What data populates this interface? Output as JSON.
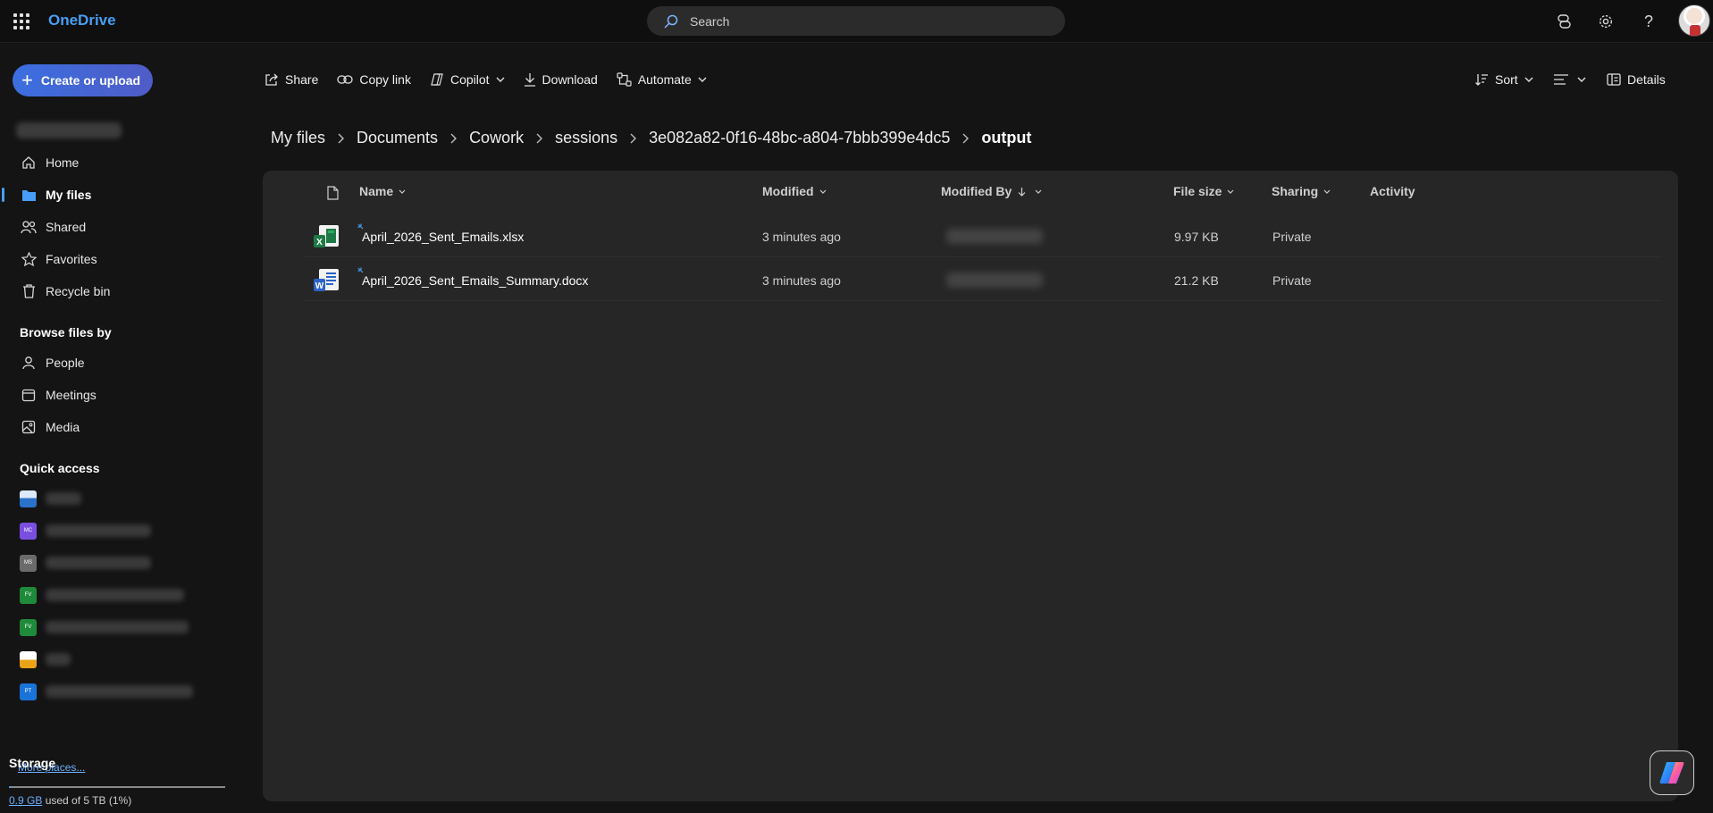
{
  "app": {
    "name": "OneDrive"
  },
  "search": {
    "placeholder": "Search"
  },
  "sidebar": {
    "create_label": "Create or upload",
    "nav": [
      {
        "label": "Home",
        "icon": "home-icon"
      },
      {
        "label": "My files",
        "icon": "folder-icon",
        "active": true
      },
      {
        "label": "Shared",
        "icon": "people-icon"
      },
      {
        "label": "Favorites",
        "icon": "star-icon"
      },
      {
        "label": "Recycle bin",
        "icon": "trash-icon"
      }
    ],
    "browse_heading": "Browse files by",
    "browse": [
      {
        "label": "People",
        "icon": "person-icon"
      },
      {
        "label": "Meetings",
        "icon": "calendar-icon"
      },
      {
        "label": "Media",
        "icon": "image-icon"
      }
    ],
    "quick_access_heading": "Quick access",
    "quick_access": [
      {
        "badge": "",
        "color": "#2a73c8"
      },
      {
        "badge": "MC",
        "color": "#7a4fe0"
      },
      {
        "badge": "MS",
        "color": "#6b6b6b"
      },
      {
        "badge": "FV",
        "color": "#1f8a3a"
      },
      {
        "badge": "FV",
        "color": "#1f8a3a"
      },
      {
        "badge": "",
        "color": "#e8a317"
      },
      {
        "badge": "PT",
        "color": "#1a73d9"
      }
    ],
    "more_places": "More places...",
    "storage_heading": "Storage",
    "storage_used": "0.9 GB",
    "storage_rest": " used of 5 TB (1%)",
    "storage_fraction": 0.01
  },
  "toolbar": {
    "share": "Share",
    "copy_link": "Copy link",
    "copilot": "Copilot",
    "download": "Download",
    "automate": "Automate",
    "sort": "Sort",
    "details": "Details"
  },
  "breadcrumb": [
    "My files",
    "Documents",
    "Cowork",
    "sessions",
    "3e082a82-0f16-48bc-a804-7bbb399e4dc5",
    "output"
  ],
  "table": {
    "headers": {
      "name": "Name",
      "modified": "Modified",
      "modified_by": "Modified By",
      "file_size": "File size",
      "sharing": "Sharing",
      "activity": "Activity"
    },
    "rows": [
      {
        "name": "April_2026_Sent_Emails.xlsx",
        "type": "excel",
        "modified": "3 minutes ago",
        "size": "9.97 KB",
        "sharing": "Private"
      },
      {
        "name": "April_2026_Sent_Emails_Summary.docx",
        "type": "word",
        "modified": "3 minutes ago",
        "size": "21.2 KB",
        "sharing": "Private"
      }
    ]
  },
  "colors": {
    "accent": "#479ef5",
    "excel": "#1d7a45",
    "word": "#2b63c6"
  }
}
